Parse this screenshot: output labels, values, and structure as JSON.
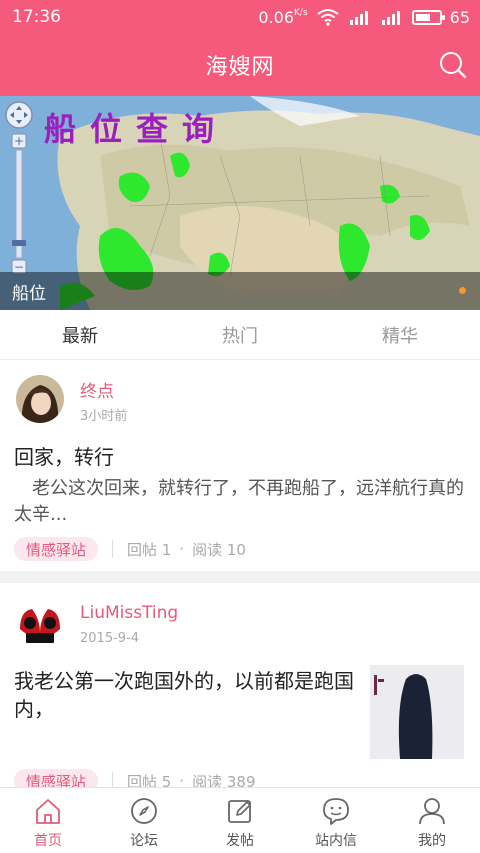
{
  "status_bar": {
    "time": "17:36",
    "network_speed": "0.06",
    "speed_unit": "K/s",
    "battery": "65",
    "battery_level_percent": 65
  },
  "header": {
    "title": "海嫂网"
  },
  "banner": {
    "title": "船位查询",
    "caption": "船位"
  },
  "tabs": [
    {
      "label": "最新",
      "active": true
    },
    {
      "label": "热门",
      "active": false
    },
    {
      "label": "精华",
      "active": false
    }
  ],
  "posts": [
    {
      "author": "终点",
      "time": "3小时前",
      "title": "回家，转行",
      "excerpt": "　老公这次回来，就转行了，不再跑船了，远洋航行真的太辛...",
      "tag": "情感驿站",
      "replies": "回帖 1",
      "reads": "阅读 10"
    },
    {
      "author": "LiuMissTing",
      "time": "2015-9-4",
      "title": "我老公第一次跑国外的，以前都是跑国内，",
      "tag": "情感驿站",
      "replies": "回帖 5",
      "reads": "阅读 389"
    }
  ],
  "bottom_nav": [
    {
      "label": "首页",
      "icon": "home-icon",
      "active": true
    },
    {
      "label": "论坛",
      "icon": "compass-icon",
      "active": false
    },
    {
      "label": "发帖",
      "icon": "edit-icon",
      "active": false
    },
    {
      "label": "站内信",
      "icon": "message-icon",
      "active": false
    },
    {
      "label": "我的",
      "icon": "user-icon",
      "active": false
    }
  ],
  "colors": {
    "brand": "#f55a7c",
    "accent_text": "#e25b7d",
    "tag_bg": "#fde7ee"
  }
}
